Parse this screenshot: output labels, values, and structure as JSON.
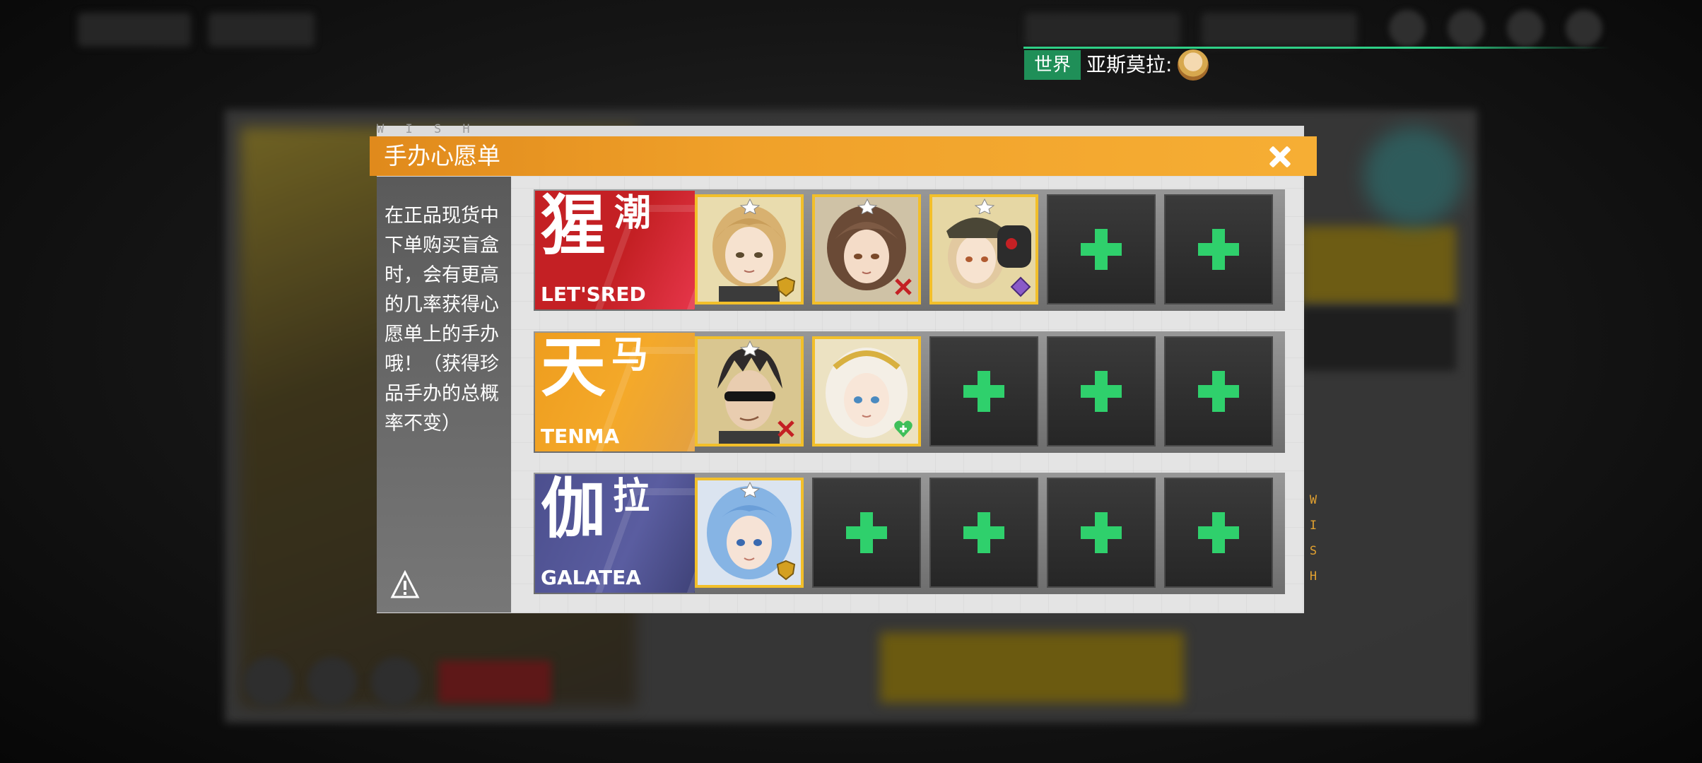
{
  "chat": {
    "channel": "世界",
    "message": "亚斯莫拉:"
  },
  "dialog": {
    "watermark_top": "W I S H",
    "title": "手办心愿单",
    "close_icon": "close-icon",
    "description": "在正品现货中下单购买盲盒时，会有更高的几率获得心愿单上的手办哦！（获得珍品手办的总概率不变）",
    "side_icon": "warning-icon",
    "watermark_side": [
      "W",
      "I",
      "S",
      "H"
    ]
  },
  "brands": [
    {
      "name_cn": "猩潮",
      "name_en": "LET'SRED",
      "accent": "#c42024",
      "figures": [
        {
          "icon": "figure-portrait-blonde",
          "badge": "shield-icon",
          "badge_color": "#d4a020"
        },
        {
          "icon": "figure-portrait-brunette",
          "badge": "cross-icon",
          "badge_color": "#c42024"
        },
        {
          "icon": "figure-portrait-cap-girl",
          "badge": "diamond-icon",
          "badge_color": "#8a5ac8"
        }
      ],
      "empty_slots": 2
    },
    {
      "name_cn": "天马",
      "name_en": "TENMA",
      "accent": "#f4a92a",
      "figures": [
        {
          "icon": "figure-portrait-visor-man",
          "badge": "cross-icon",
          "badge_color": "#c42024"
        },
        {
          "icon": "figure-portrait-white-hair",
          "badge": "heart-plus-icon",
          "badge_color": "#3fbf5a"
        }
      ],
      "empty_slots": 3
    },
    {
      "name_cn": "伽拉",
      "name_en": "GALATEA",
      "accent": "#5a5da0",
      "figures": [
        {
          "icon": "figure-portrait-blue-hair",
          "badge": "shield-icon",
          "badge_color": "#d4a020"
        }
      ],
      "empty_slots": 4
    }
  ],
  "colors": {
    "header_orange": "#f0a12a",
    "plus_green": "#2fd06c",
    "slot_border_gold": "#f2bf2a",
    "chat_green": "#1f8f58"
  }
}
